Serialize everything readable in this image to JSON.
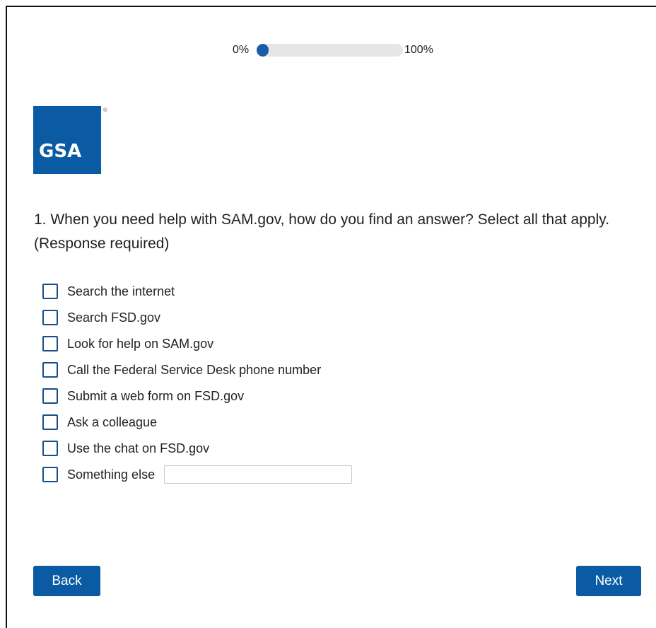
{
  "progress": {
    "start_label": "0%",
    "end_label": "100%",
    "value_percent": 0
  },
  "logo": {
    "text": "GSA",
    "registered_mark": "®",
    "color": "#0a5aa4"
  },
  "question": {
    "text": "1. When you need help with SAM.gov, how do you find an answer? Select all that apply. (Response required)"
  },
  "options": [
    {
      "label": "Search the internet",
      "checked": false
    },
    {
      "label": "Search FSD.gov",
      "checked": false
    },
    {
      "label": "Look for help on SAM.gov",
      "checked": false
    },
    {
      "label": "Call the Federal Service Desk phone number",
      "checked": false
    },
    {
      "label": "Submit a web form on FSD.gov",
      "checked": false
    },
    {
      "label": "Ask a colleague",
      "checked": false
    },
    {
      "label": "Use the chat on FSD.gov",
      "checked": false
    },
    {
      "label": "Something else",
      "checked": false,
      "other_value": "",
      "other_placeholder": ""
    }
  ],
  "nav": {
    "back_label": "Back",
    "next_label": "Next",
    "button_color": "#0a5aa4"
  }
}
